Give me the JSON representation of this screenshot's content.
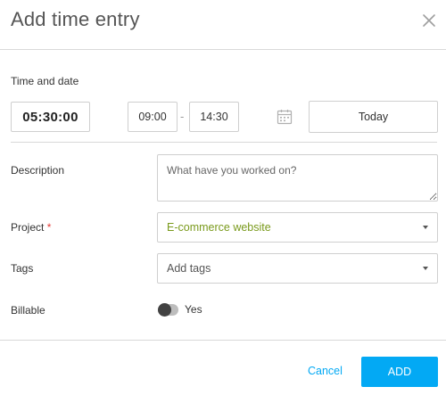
{
  "dialog": {
    "title": "Add time entry",
    "close_icon": "close-icon"
  },
  "time": {
    "section_label": "Time and date",
    "duration": "05:30:00",
    "start": "09:00",
    "separator": "-",
    "end": "14:30",
    "calendar_icon": "calendar-icon",
    "date": "Today"
  },
  "description": {
    "label": "Description",
    "placeholder": "What have you worked on?"
  },
  "project": {
    "label": "Project",
    "required_marker": "*",
    "value": "E-commerce website",
    "value_color": "#7a9a1c"
  },
  "tags": {
    "label": "Tags",
    "placeholder": "Add tags"
  },
  "billable": {
    "label": "Billable",
    "toggle_label": "Yes",
    "enabled": false
  },
  "footer": {
    "cancel_label": "Cancel",
    "add_label": "ADD",
    "accent_color": "#03a9f4"
  }
}
